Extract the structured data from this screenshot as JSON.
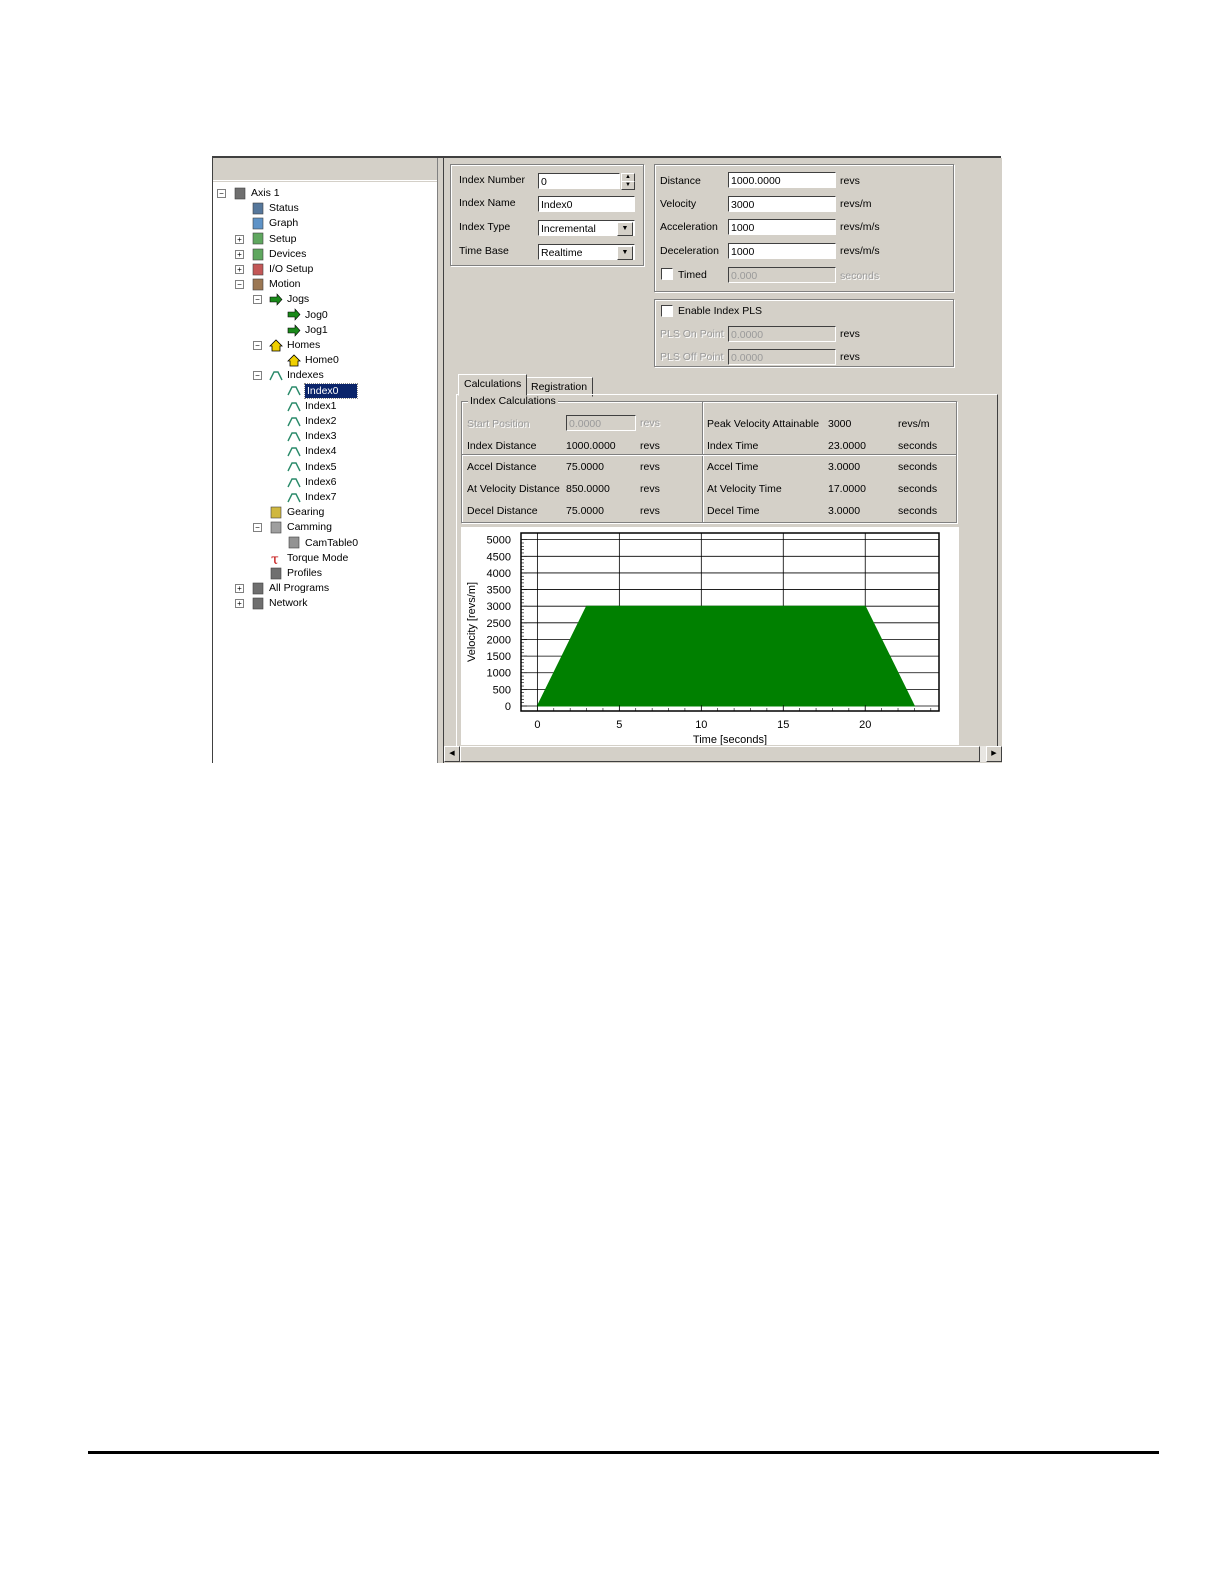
{
  "tree": {
    "nodes": [
      {
        "label": "Axis 1",
        "icon": "axis-drive-icon"
      },
      {
        "label": "Status",
        "icon": "status-monitor-icon"
      },
      {
        "label": "Graph",
        "icon": "graph-icon"
      },
      {
        "label": "Setup",
        "icon": "setup-wrench-icon"
      },
      {
        "label": "Devices",
        "icon": "devices-icon"
      },
      {
        "label": "I/O Setup",
        "icon": "io-setup-icon"
      },
      {
        "label": "Motion",
        "icon": "motion-icon"
      },
      {
        "label": "Jogs",
        "icon": "jog-arrow-icon"
      },
      {
        "label": "Jog0",
        "icon": "jog-arrow-icon"
      },
      {
        "label": "Jog1",
        "icon": "jog-arrow-icon"
      },
      {
        "label": "Homes",
        "icon": "home-icon"
      },
      {
        "label": "Home0",
        "icon": "home-icon"
      },
      {
        "label": "Indexes",
        "icon": "index-profile-icon"
      },
      {
        "label": "Index0",
        "icon": "index-profile-icon"
      },
      {
        "label": "Index1",
        "icon": "index-profile-icon"
      },
      {
        "label": "Index2",
        "icon": "index-profile-icon"
      },
      {
        "label": "Index3",
        "icon": "index-profile-icon"
      },
      {
        "label": "Index4",
        "icon": "index-profile-icon"
      },
      {
        "label": "Index5",
        "icon": "index-profile-icon"
      },
      {
        "label": "Index6",
        "icon": "index-profile-icon"
      },
      {
        "label": "Index7",
        "icon": "index-profile-icon"
      },
      {
        "label": "Gearing",
        "icon": "gearing-icon"
      },
      {
        "label": "Camming",
        "icon": "camming-icon"
      },
      {
        "label": "CamTable0",
        "icon": "cam-table-icon"
      },
      {
        "label": "Torque Mode",
        "icon": "torque-tau-icon"
      },
      {
        "label": "Profiles",
        "icon": "profiles-icon"
      },
      {
        "label": "All Programs",
        "icon": "programs-icon"
      },
      {
        "label": "Network",
        "icon": "network-icon"
      }
    ],
    "selected": "Index0"
  },
  "index": {
    "number_label": "Index Number",
    "number_value": "0",
    "name_label": "Index Name",
    "name_value": "Index0",
    "type_label": "Index Type",
    "type_value": "Incremental",
    "timebase_label": "Time Base",
    "timebase_value": "Realtime"
  },
  "motion": {
    "distance_label": "Distance",
    "distance_value": "1000.0000",
    "distance_unit": "revs",
    "velocity_label": "Velocity",
    "velocity_value": "3000",
    "velocity_unit": "revs/m",
    "accel_label": "Acceleration",
    "accel_value": "1000",
    "accel_unit": "revs/m/s",
    "decel_label": "Deceleration",
    "decel_value": "1000",
    "decel_unit": "revs/m/s",
    "timed_label": "Timed",
    "timed_value": "0.000",
    "timed_unit": "seconds"
  },
  "pls": {
    "enable_label": "Enable Index PLS",
    "on_label": "PLS On Point",
    "on_value": "0.0000",
    "on_unit": "revs",
    "off_label": "PLS Off Point",
    "off_value": "0.0000",
    "off_unit": "revs"
  },
  "tabs": [
    "Calculations",
    "Registration"
  ],
  "calc": {
    "group_title": "Index Calculations",
    "start_label": "Start Position",
    "start_value": "0.0000",
    "start_unit": "revs",
    "dist_label": "Index Distance",
    "dist_value": "1000.0000",
    "dist_unit": "revs",
    "peak_label": "Peak Velocity Attainable",
    "peak_value": "3000",
    "peak_unit": "revs/m",
    "time_label": "Index Time",
    "time_value": "23.0000",
    "time_unit": "seconds",
    "accel_dist_label": "Accel Distance",
    "accel_dist_value": "75.0000",
    "accel_dist_unit": "revs",
    "atvel_dist_label": "At Velocity Distance",
    "atvel_dist_value": "850.0000",
    "atvel_dist_unit": "revs",
    "decel_dist_label": "Decel Distance",
    "decel_dist_value": "75.0000",
    "decel_dist_unit": "revs",
    "accel_time_label": "Accel Time",
    "accel_time_value": "3.0000",
    "accel_time_unit": "seconds",
    "atvel_time_label": "At Velocity Time",
    "atvel_time_value": "17.0000",
    "atvel_time_unit": "seconds",
    "decel_time_label": "Decel Time",
    "decel_time_value": "3.0000",
    "decel_time_unit": "seconds"
  },
  "chart_data": {
    "type": "area",
    "x": [
      0,
      3,
      20,
      23
    ],
    "y": [
      0,
      3000,
      3000,
      0
    ],
    "xlabel": "Time [seconds]",
    "ylabel": "Velocity [revs/m]",
    "xlim": [
      -1,
      24.5
    ],
    "ylim": [
      -150,
      5200
    ],
    "xticks": [
      0,
      5,
      10,
      15,
      20
    ],
    "yticks": [
      0,
      500,
      1000,
      1500,
      2000,
      2500,
      3000,
      3500,
      4000,
      4500,
      5000
    ],
    "fill_color": "#008000",
    "grid": true
  },
  "colors": {
    "panel": "#d4d0c8",
    "selection": "#0a246a",
    "area": "#008000"
  }
}
